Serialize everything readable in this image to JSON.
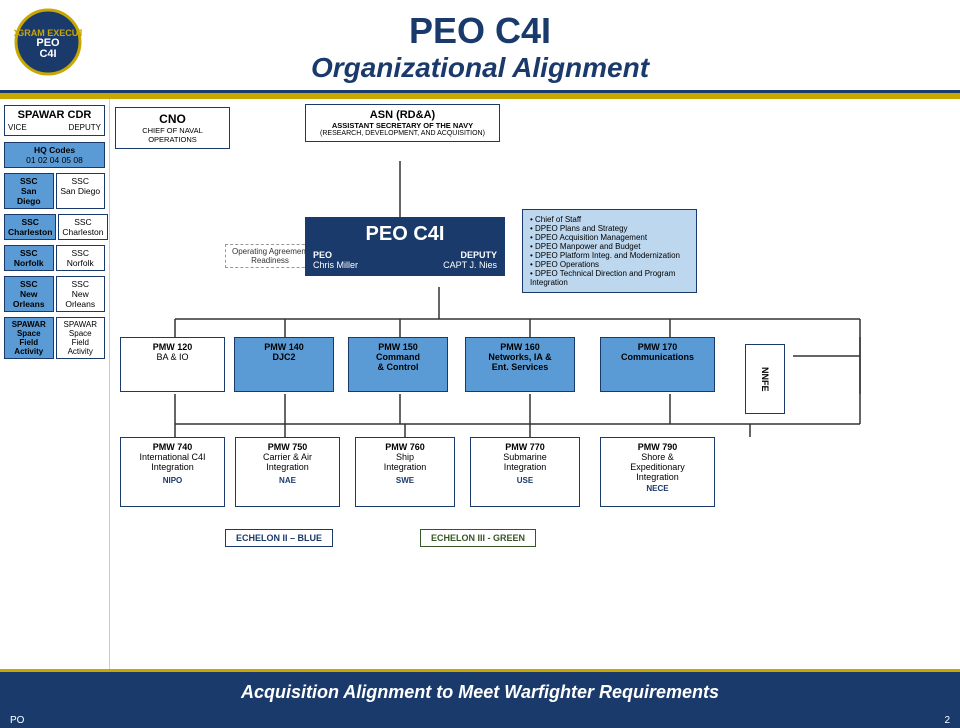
{
  "header": {
    "title_main": "PEO C4I",
    "title_sub": "Organizational Alignment",
    "logo_text": "PEO C4I"
  },
  "sidebar": {
    "top_box": {
      "title": "SPAWAR CDR",
      "vice": "VICE",
      "deputy": "DEPUTY"
    },
    "items": [
      {
        "id": "hq",
        "line1": "HQ Codes",
        "line2": "01  02  04  05  08",
        "blue": true
      },
      {
        "id": "ssc-san-diego",
        "line1": "SSC",
        "line2": "San Diego",
        "blue": true
      },
      {
        "id": "ssc-charleston",
        "line1": "SSC",
        "line2": "Charleston",
        "blue": true
      },
      {
        "id": "ssc-norfolk",
        "line1": "SSC",
        "line2": "Norfolk",
        "blue": true
      },
      {
        "id": "ssc-new-orleans",
        "line1": "SSC",
        "line2": "New Orleans",
        "blue": true
      },
      {
        "id": "spawar-space",
        "line1": "SPAWAR Space",
        "line2": "Field Activity",
        "blue": true
      }
    ]
  },
  "cno_box": {
    "title": "CNO",
    "sub": "CHIEF OF NAVAL OPERATIONS"
  },
  "asn_box": {
    "title": "ASN (RD&A)",
    "line1": "ASSISTANT SECRETARY OF THE NAVY",
    "line2": "(RESEARCH, DEVELOPMENT, AND ACQUISITION)"
  },
  "peo_box": {
    "title": "PEO C4I",
    "peo_label": "PEO",
    "peo_name": "Chris Miller",
    "deputy_label": "DEPUTY",
    "deputy_name": "CAPT J. Nies"
  },
  "info_bullets": [
    "Chief of Staff",
    "DPEO Plans and Strategy",
    "DPEO Acquisition Management",
    "DPEO Manpower and Budget",
    "DPEO Platform Integ. and Modernization",
    "DPEO Operations",
    "DPEO Technical Direction and Program Integration"
  ],
  "operating_agreement": "Operating Agreement\nReadiness",
  "pmw_row1": [
    {
      "id": "pmw120",
      "title": "PMW 120",
      "sub": "BA & IO"
    },
    {
      "id": "pmw140",
      "title": "PMW 140",
      "sub": "DJC2"
    },
    {
      "id": "pmw150",
      "title": "PMW 150",
      "sub": "Command\n& Control"
    },
    {
      "id": "pmw160",
      "title": "PMW 160",
      "sub": "Networks, IA &\nEnt. Services"
    },
    {
      "id": "pmw170",
      "title": "PMW 170",
      "sub": "Communications"
    }
  ],
  "pmw_row2": [
    {
      "id": "pmw740",
      "title": "PMW 740",
      "sub": "International C4I\nIntegration",
      "label": "NIPO"
    },
    {
      "id": "pmw750",
      "title": "PMW 750",
      "sub": "Carrier & Air\nIntegration",
      "label": "NAE"
    },
    {
      "id": "pmw760",
      "title": "PMW 760",
      "sub": "Ship\nIntegration",
      "label": "SWE"
    },
    {
      "id": "pmw770",
      "title": "PMW 770",
      "sub": "Submarine\nIntegration",
      "label": "USE"
    },
    {
      "id": "pmw790",
      "title": "PMW 790",
      "sub": "Shore &\nExpeditionary\nIntegration",
      "label": "NECE"
    }
  ],
  "nnfe_label": "NNFE",
  "echelon_blue": "ECHELON II  – BLUE",
  "echelon_green": "ECHELON III  - GREEN",
  "bottom_bar": "Acquisition Alignment to Meet Warfighter Requirements",
  "footer": {
    "left": "PO",
    "right": "2"
  }
}
